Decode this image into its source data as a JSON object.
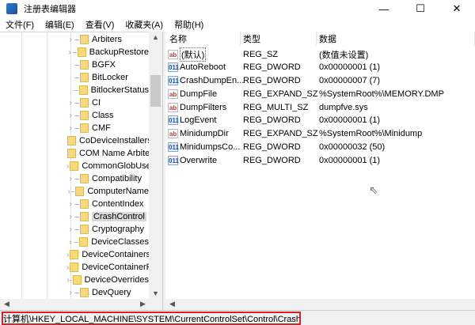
{
  "window": {
    "title": "注册表编辑器",
    "minimize": "—",
    "maximize": "☐",
    "close": "✕"
  },
  "menu": [
    "文件(F)",
    "编辑(E)",
    "查看(V)",
    "收藏夹(A)",
    "帮助(H)"
  ],
  "tree": [
    {
      "label": "Arbiters",
      "expandable": true
    },
    {
      "label": "BackupRestore",
      "expandable": true
    },
    {
      "label": "BGFX",
      "expandable": false
    },
    {
      "label": "BitLocker",
      "expandable": false
    },
    {
      "label": "BitlockerStatus",
      "expandable": false
    },
    {
      "label": "CI",
      "expandable": true
    },
    {
      "label": "Class",
      "expandable": true
    },
    {
      "label": "CMF",
      "expandable": true
    },
    {
      "label": "CoDeviceInstallers",
      "expandable": false
    },
    {
      "label": "COM Name Arbiter",
      "expandable": false
    },
    {
      "label": "CommonGlobUserSettings",
      "expandable": true
    },
    {
      "label": "Compatibility",
      "expandable": true
    },
    {
      "label": "ComputerName",
      "expandable": true
    },
    {
      "label": "ContentIndex",
      "expandable": true
    },
    {
      "label": "CrashControl",
      "expandable": true,
      "selected": true
    },
    {
      "label": "Cryptography",
      "expandable": true
    },
    {
      "label": "DeviceClasses",
      "expandable": true
    },
    {
      "label": "DeviceContainers",
      "expandable": true
    },
    {
      "label": "DeviceContainerPropertyUpdateEvents",
      "expandable": true
    },
    {
      "label": "DeviceOverrides",
      "expandable": true
    },
    {
      "label": "DevQuery",
      "expandable": true
    }
  ],
  "columns": {
    "name": "名称",
    "type": "类型",
    "data": "数据"
  },
  "values": [
    {
      "icon": "ab",
      "name": "(默认)",
      "type": "REG_SZ",
      "data": "(数值未设置)"
    },
    {
      "icon": "bin",
      "name": "AutoReboot",
      "type": "REG_DWORD",
      "data": "0x00000001 (1)"
    },
    {
      "icon": "bin",
      "name": "CrashDumpEn...",
      "type": "REG_DWORD",
      "data": "0x00000007 (7)"
    },
    {
      "icon": "ab",
      "name": "DumpFile",
      "type": "REG_EXPAND_SZ",
      "data": "%SystemRoot%\\MEMORY.DMP"
    },
    {
      "icon": "ab",
      "name": "DumpFilters",
      "type": "REG_MULTI_SZ",
      "data": "dumpfve.sys"
    },
    {
      "icon": "bin",
      "name": "LogEvent",
      "type": "REG_DWORD",
      "data": "0x00000001 (1)"
    },
    {
      "icon": "ab",
      "name": "MinidumpDir",
      "type": "REG_EXPAND_SZ",
      "data": "%SystemRoot%\\Minidump"
    },
    {
      "icon": "bin",
      "name": "MinidumpsCo...",
      "type": "REG_DWORD",
      "data": "0x00000032 (50)"
    },
    {
      "icon": "bin",
      "name": "Overwrite",
      "type": "REG_DWORD",
      "data": "0x00000001 (1)"
    }
  ],
  "status": {
    "path": "计算机\\HKEY_LOCAL_MACHINE\\SYSTEM\\CurrentControlSet\\Control\\CrashControl",
    "highlight_color": "#e02020"
  }
}
